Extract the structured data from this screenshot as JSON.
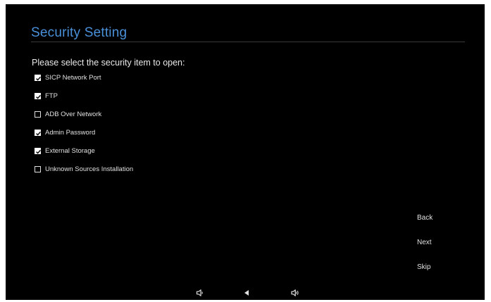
{
  "header": {
    "title": "Security Setting",
    "accent_color": "#4a90d9"
  },
  "prompt": "Please select the security item to open:",
  "options": [
    {
      "label": "SICP Network Port",
      "checked": true
    },
    {
      "label": "FTP",
      "checked": true
    },
    {
      "label": "ADB Over Network",
      "checked": false
    },
    {
      "label": "Admin Password",
      "checked": true
    },
    {
      "label": "External Storage",
      "checked": true
    },
    {
      "label": "Unknown Sources Installation",
      "checked": false
    }
  ],
  "buttons": {
    "back": "Back",
    "next": "Next",
    "skip": "Skip"
  },
  "navbar": {
    "icons": [
      "volume-down-icon",
      "back-triangle-icon",
      "volume-up-icon"
    ]
  }
}
